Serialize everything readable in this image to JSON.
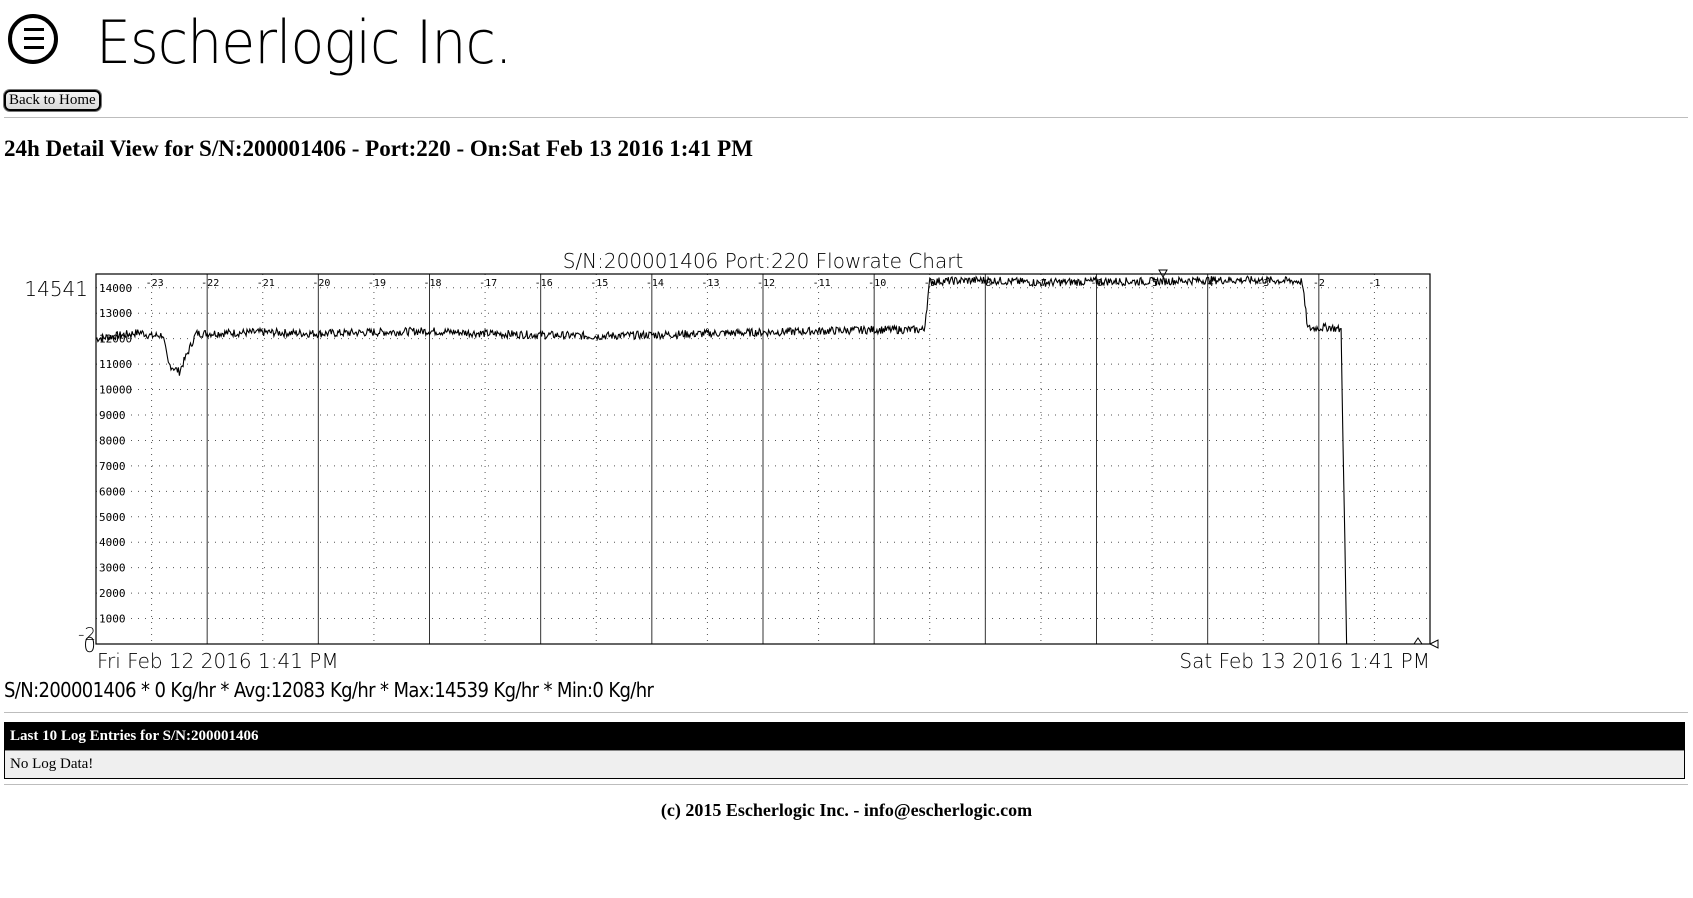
{
  "header": {
    "company_name": "Escherlogic Inc.",
    "logo_icon": "escherlogic-logo-icon"
  },
  "nav": {
    "back_home_label": "Back to Home"
  },
  "page": {
    "title": "24h Detail View for S/N:200001406 - Port:220 - On:Sat Feb 13 2016 1:41 PM"
  },
  "chart_data": {
    "type": "line",
    "title": "S/N:200001406 Port:220 Flowrate Chart",
    "ylim": [
      0,
      14541
    ],
    "y_ticks": [
      1000,
      2000,
      3000,
      4000,
      5000,
      6000,
      7000,
      8000,
      9000,
      10000,
      11000,
      12000,
      13000,
      14000
    ],
    "y_max_label": "14541",
    "y_min_label": "0",
    "y_offset_label": "-2",
    "hour_ticks": [
      "-23",
      "-22",
      "-21",
      "-20",
      "-19",
      "-18",
      "-17",
      "-16",
      "-15",
      "-14",
      "-13",
      "-12",
      "-11",
      "-10",
      "-9",
      "-8",
      "-7",
      "-6",
      "-5",
      "-4",
      "-3",
      "-2",
      "-1"
    ],
    "x_start_label": "Fri Feb 12 2016  1:41 PM",
    "x_end_label": "Sat Feb 13 2016  1:41 PM",
    "grid": true,
    "x_unit": "hours before Sat Feb 13 2016 1:41 PM",
    "series": [
      {
        "values_x": [
          -24,
          -23.2,
          -23.0,
          -22.8,
          -22.7,
          -22.5,
          -22.2,
          -21,
          -20,
          -19,
          -18,
          -17,
          -16,
          -15,
          -14,
          -13,
          -12,
          -11,
          -10,
          -9.1,
          -9.0,
          -8,
          -7,
          -6,
          -5,
          -4,
          -3,
          -2.3,
          -2.2,
          -1.8,
          -1.6,
          -1.5,
          0
        ],
        "values_y": [
          12000,
          12250,
          12100,
          12150,
          11000,
          10700,
          12200,
          12250,
          12200,
          12250,
          12300,
          12200,
          12150,
          12100,
          12150,
          12200,
          12250,
          12300,
          12350,
          12350,
          14250,
          14300,
          14200,
          14250,
          14250,
          14300,
          14300,
          14250,
          12400,
          12450,
          12350,
          0,
          0
        ],
        "noise": 160
      }
    ]
  },
  "stats": {
    "text": "S/N:200001406 * 0 Kg/hr * Avg:12083 Kg/hr * Max:14539 Kg/hr * Min:0 Kg/hr"
  },
  "log": {
    "header": "Last 10 Log Entries for S/N:200001406",
    "empty_message": "No Log Data!"
  },
  "footer": {
    "text": "(c) 2015 Escherlogic Inc. - info@escherlogic.com"
  }
}
